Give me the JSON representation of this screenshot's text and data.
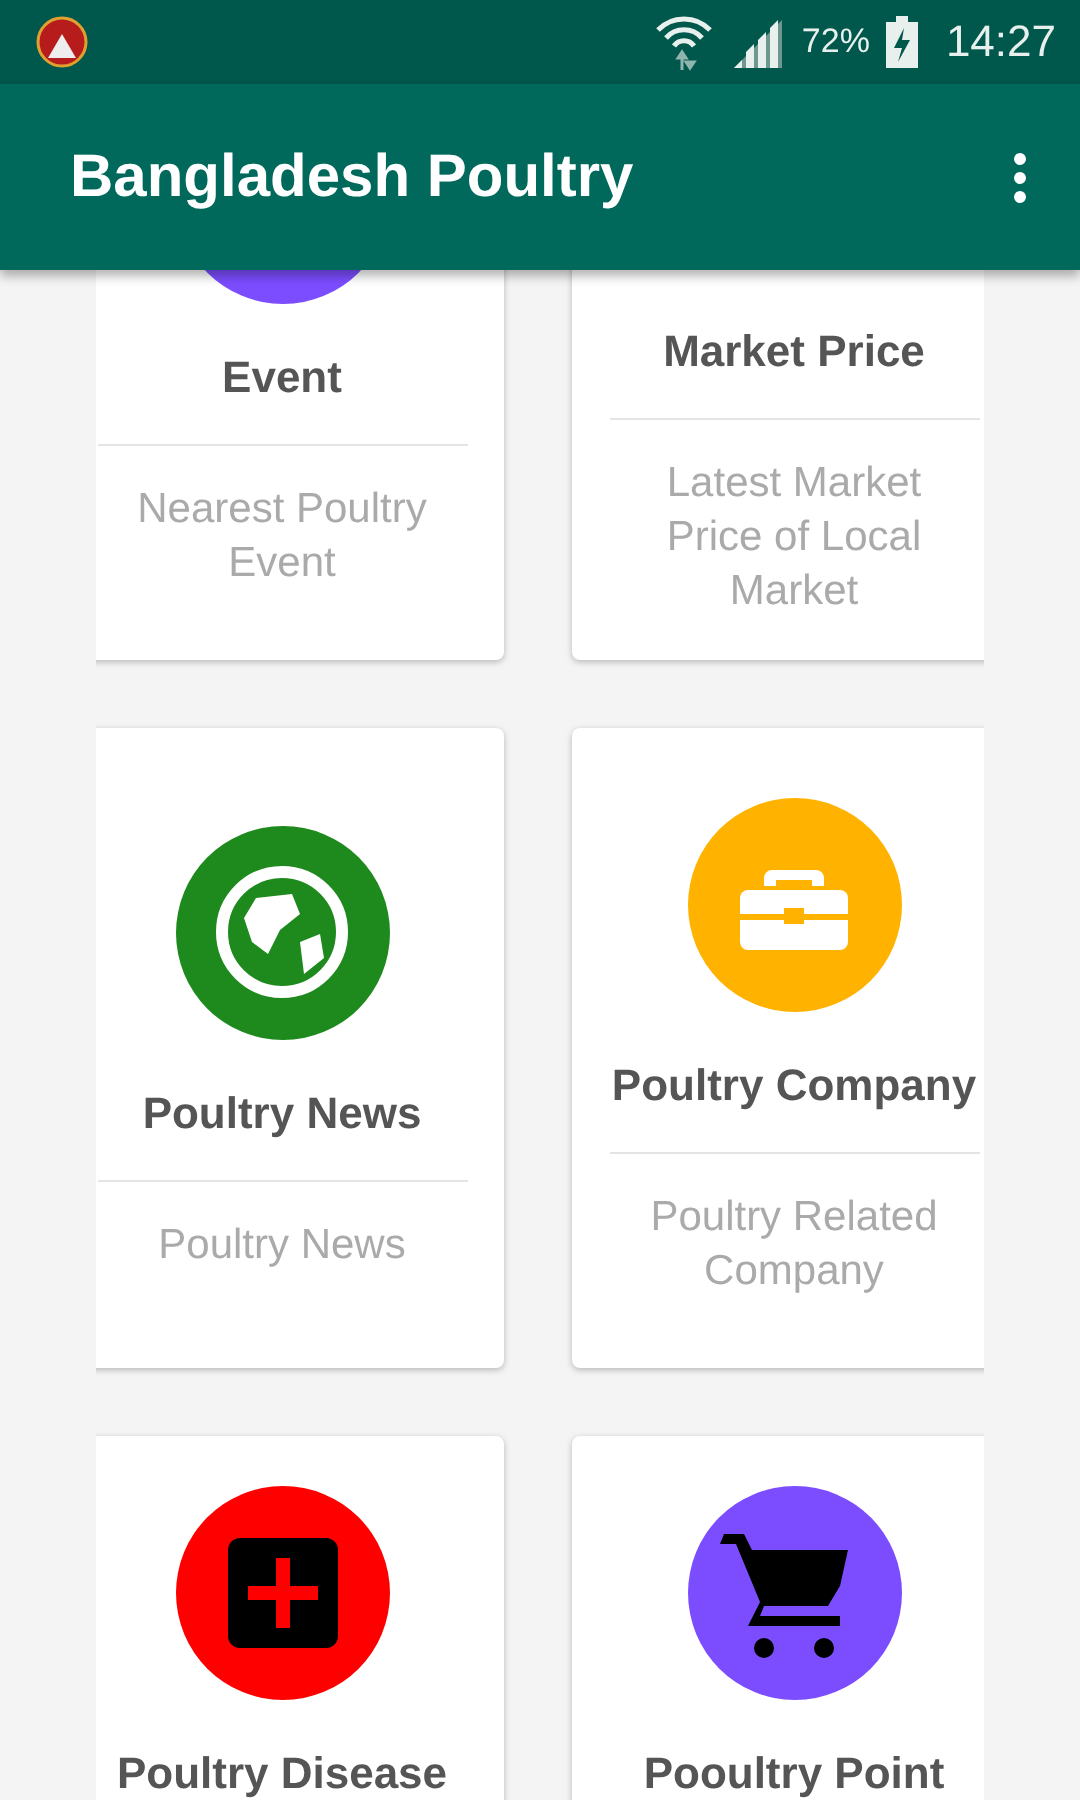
{
  "status_bar": {
    "battery": "72%",
    "time": "14:27"
  },
  "app_bar": {
    "title": "Bangladesh Poultry"
  },
  "card_rows": [
    {
      "cards": [
        {
          "title": "Event",
          "description": "Nearest Poultry Event",
          "icon": {
            "kind": "circle",
            "color": "#7c4dff"
          }
        },
        {
          "title": "Market Price",
          "description": "Latest Market Price of Local Market"
        }
      ]
    },
    {
      "cards": [
        {
          "title": "Poultry News",
          "description": "Poultry News",
          "icon": {
            "kind": "globe",
            "color": "#1e8a1e"
          }
        },
        {
          "title": "Poultry Company",
          "description": "Poultry Related Company",
          "icon": {
            "kind": "briefcase",
            "color": "#ffb300"
          }
        }
      ]
    },
    {
      "cards": [
        {
          "title": "Poultry Disease",
          "icon": {
            "kind": "medical",
            "color": "#ff0000"
          }
        },
        {
          "title": "Pooultry Point",
          "icon": {
            "kind": "cart",
            "color": "#7c4dff"
          }
        }
      ]
    }
  ]
}
